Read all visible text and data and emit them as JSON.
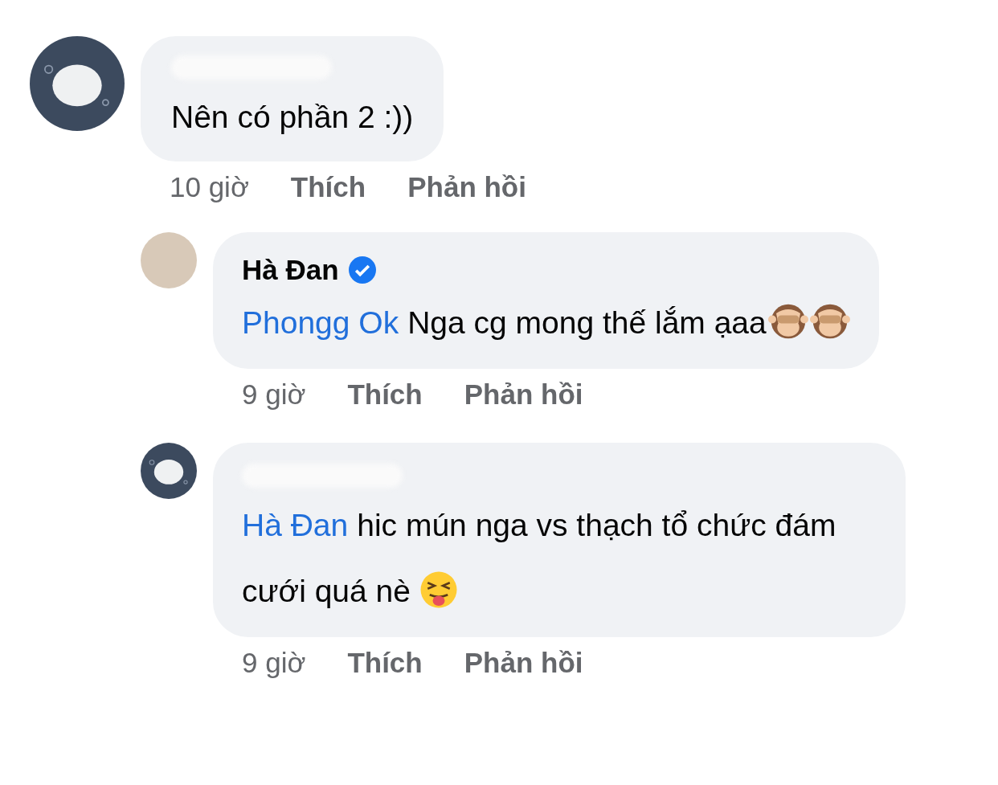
{
  "comments": [
    {
      "kind": "plain",
      "reply": false,
      "body": [
        {
          "kind": "text",
          "text": "Nên có phần 2 :))"
        }
      ],
      "time": "10 giờ",
      "like": "Thích",
      "respond": "Phản hồi"
    },
    {
      "kind": "photo",
      "name": "Hà Đan",
      "verified": true,
      "reply": true,
      "body": [
        {
          "kind": "mention",
          "text": "Phongg Ok"
        },
        {
          "kind": "text",
          "text": "Nga cg mong thế lắm ạaa"
        },
        {
          "kind": "monkey"
        },
        {
          "kind": "monkey"
        }
      ],
      "time": "9 giờ",
      "like": "Thích",
      "respond": "Phản hồi"
    },
    {
      "kind": "plain",
      "reply": true,
      "body": [
        {
          "kind": "mention",
          "text": "Hà Đan"
        },
        {
          "kind": "text",
          "text": "hic mún nga vs thạch tổ chức đám cưới quá nè"
        },
        {
          "kind": "tongue"
        }
      ],
      "time": "9 giờ",
      "like": "Thích",
      "respond": "Phản hồi"
    }
  ]
}
